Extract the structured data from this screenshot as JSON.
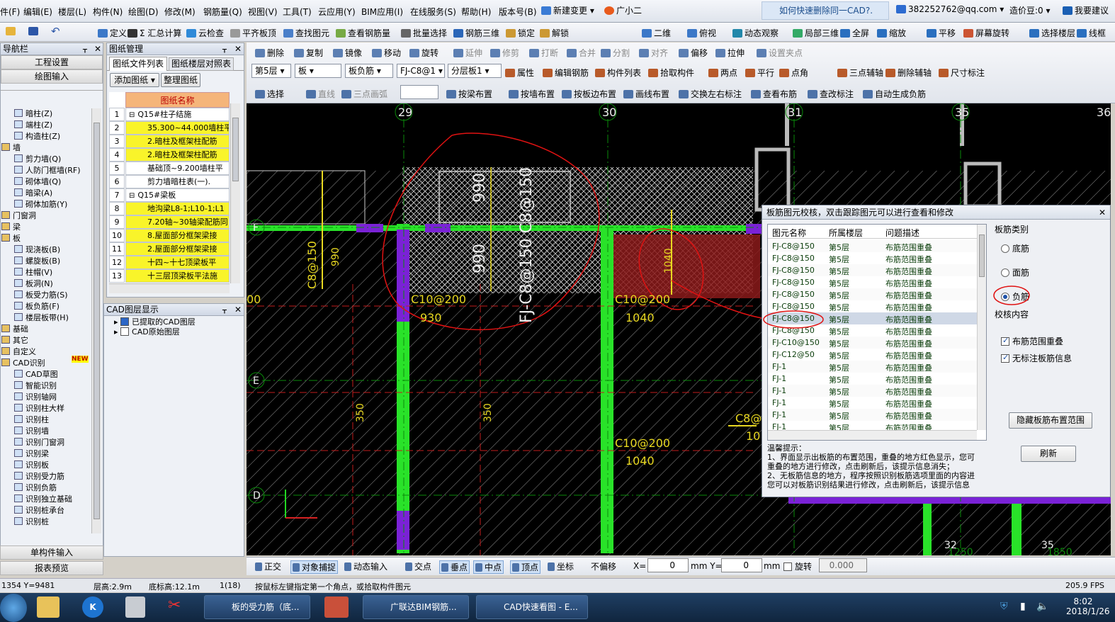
{
  "menubar": {
    "items": [
      "件(F)",
      "编辑(E)",
      "楼层(L)",
      "构件(N)",
      "绘图(D)",
      "修改(M)",
      "钢筋量(Q)",
      "视图(V)",
      "工具(T)",
      "云应用(Y)",
      "BIM应用(I)",
      "在线服务(S)",
      "帮助(H)",
      "版本号(B)"
    ],
    "new_change": "新建变更",
    "assistant": "广小二",
    "search_hint": "如何快速删除同一CAD?.",
    "account": "382252762@qq.com",
    "cost_beans": "造价豆:0",
    "feedback": "我要建议"
  },
  "toolbar1": {
    "items": [
      "定义",
      "Σ 汇总计算",
      "云检查",
      "平齐板顶",
      "查找图元",
      "查看钢筋量",
      "批量选择",
      "钢筋三维",
      "锁定",
      "解锁",
      "二维",
      "俯视",
      "动态观察",
      "局部三维",
      "全屏",
      "缩放",
      "平移",
      "屏幕旋转",
      "选择楼层",
      "线框"
    ]
  },
  "nav": {
    "title": "导航栏",
    "project_settings": "工程设置",
    "drawing_input": "绘图输入",
    "tree": [
      "暗柱(Z)",
      "端柱(Z)",
      "构造柱(Z)",
      "墙",
      "剪力墙(Q)",
      "人防门框墙(RF)",
      "砌体墙(Q)",
      "暗梁(A)",
      "砌体加筋(Y)",
      "门窗洞",
      "梁",
      "板",
      "现浇板(B)",
      "螺旋板(B)",
      "柱帽(V)",
      "板洞(N)",
      "板受力筋(S)",
      "板负筋(F)",
      "楼层板带(H)",
      "基础",
      "其它",
      "自定义",
      "CAD识别",
      "CAD草图",
      "智能识别",
      "识别轴网",
      "识别柱大样",
      "识别柱",
      "识别墙",
      "识别门窗洞",
      "识别梁",
      "识别板",
      "识别受力筋",
      "识别负筋",
      "识别独立基础",
      "识别桩承台",
      "识别桩"
    ],
    "new_badge": "NEW",
    "single_input": "单构件输入",
    "report_preview": "报表预览"
  },
  "drawings": {
    "title": "图纸管理",
    "tab1": "图纸文件列表",
    "tab2": "图纸楼层对照表",
    "add": "添加图纸",
    "organize": "整理图纸",
    "col": "图纸名称",
    "rows": [
      [
        "1",
        "Q15#柱子结施"
      ],
      [
        "2",
        "35.300~44.000墙柱平"
      ],
      [
        "3",
        "2.暗柱及框架柱配筋"
      ],
      [
        "4",
        "2.暗柱及框架柱配筋"
      ],
      [
        "5",
        "基础顶~9.200墙柱平"
      ],
      [
        "6",
        "剪力墙暗柱表(一)."
      ],
      [
        "7",
        "Q15#梁板"
      ],
      [
        "8",
        "地沟梁L8-1;L10-1;L1"
      ],
      [
        "9",
        "7.20轴~30轴梁配筋同"
      ],
      [
        "10",
        "8.屋面部分框架梁接"
      ],
      [
        "11",
        "2.屋面部分框架梁接"
      ],
      [
        "12",
        "十四~十七顶梁板平"
      ],
      [
        "13",
        "十三层顶梁板平法施"
      ]
    ]
  },
  "cad_layers": {
    "title": "CAD图层显示",
    "items": [
      "已提取的CAD图层",
      "CAD原始图层"
    ]
  },
  "toolbar2": {
    "items": [
      "删除",
      "复制",
      "镜像",
      "移动",
      "旋转",
      "延伸",
      "修剪",
      "打断",
      "合并",
      "分割",
      "对齐",
      "偏移",
      "拉伸",
      "设置夹点"
    ]
  },
  "toolbar3": {
    "floor": "第5层",
    "category": "板",
    "type": "板负筋",
    "element": "FJ-C8@1",
    "layer": "分层板1",
    "items": [
      "属性",
      "编辑钢筋",
      "构件列表",
      "拾取构件",
      "两点",
      "平行",
      "点角",
      "三点辅轴",
      "删除辅轴",
      "尺寸标注"
    ]
  },
  "toolbar4": {
    "items": [
      "选择",
      "直线",
      "三点画弧",
      "按梁布置",
      "按墙布置",
      "按板边布置",
      "画线布置",
      "交换左右标注",
      "查看布筋",
      "查改标注",
      "自动生成负筋"
    ]
  },
  "canvas": {
    "axes": [
      "29",
      "30",
      "31",
      "35",
      "36"
    ],
    "row_axes": [
      "F",
      "E",
      "D"
    ],
    "labels": [
      "990",
      "990",
      "C8@150",
      "990",
      "FJ-C8@150 C8@150",
      "C10@200",
      "930",
      "C10@200",
      "1040",
      "C10@200",
      "1040",
      "350",
      "350",
      "1040",
      "00",
      "C8@",
      "10",
      "32",
      "35",
      "1250",
      "1850"
    ]
  },
  "dialog": {
    "title": "板筋图元校核，双击跟踪图元可以进行查看和修改",
    "cols": [
      "图元名称",
      "所属楼层",
      "问题描述"
    ],
    "rows": [
      [
        "FJ-C8@150",
        "第5层",
        "布筋范围重叠"
      ],
      [
        "FJ-C8@150",
        "第5层",
        "布筋范围重叠"
      ],
      [
        "FJ-C8@150",
        "第5层",
        "布筋范围重叠"
      ],
      [
        "FJ-C8@150",
        "第5层",
        "布筋范围重叠"
      ],
      [
        "FJ-C8@150",
        "第5层",
        "布筋范围重叠"
      ],
      [
        "FJ-C8@150",
        "第5层",
        "布筋范围重叠"
      ],
      [
        "FJ-C8@150",
        "第5层",
        "布筋范围重叠"
      ],
      [
        "FJ-C8@150",
        "第5层",
        "布筋范围重叠"
      ],
      [
        "FJ-C10@150",
        "第5层",
        "布筋范围重叠"
      ],
      [
        "FJ-C12@50",
        "第5层",
        "布筋范围重叠"
      ],
      [
        "FJ-1",
        "第5层",
        "布筋范围重叠"
      ],
      [
        "FJ-1",
        "第5层",
        "布筋范围重叠"
      ],
      [
        "FJ-1",
        "第5层",
        "布筋范围重叠"
      ],
      [
        "FJ-1",
        "第5层",
        "布筋范围重叠"
      ],
      [
        "FJ-1",
        "第5层",
        "布筋范围重叠"
      ],
      [
        "FJ-1",
        "第5层",
        "布筋范围重叠"
      ]
    ],
    "category_label": "板筋类别",
    "opt_bottom": "底筋",
    "opt_top": "面筋",
    "opt_neg": "负筋",
    "check_label": "校核内容",
    "chk1": "布筋范围重叠",
    "chk2": "无标注板筋信息",
    "hide_btn": "隐藏板筋布置范围",
    "refresh_btn": "刷新",
    "tips": [
      "温馨提示：",
      "1、界面显示出板筋的布置范围，重叠的地方红色显示，您可",
      "重叠的地方进行修改，点击刷新后，该提示信息消失；",
      "2、无板筋信息的地方，程序按照识别板筋选项里面的内容进",
      "您可以对板筋识别结果进行修改，点击刷新后，该提示信息"
    ]
  },
  "snapbar": {
    "items": [
      "正交",
      "对象捕捉",
      "动态输入",
      "交点",
      "垂点",
      "中点",
      "顶点",
      "坐标",
      "不偏移"
    ],
    "x_label": "X=",
    "x_val": "0",
    "y_label": "mm Y=",
    "y_val": "0",
    "unit": "mm",
    "rotate": "旋转",
    "rot_val": "0.000"
  },
  "status": {
    "coords": "1354 Y=9481",
    "floor_height": "层高:2.9m",
    "bottom_height": "底标高:12.1m",
    "count": "1(18)",
    "hint": "按鼠标左键指定第一个角点，或拾取构件图元",
    "fps": "205.9 FPS"
  },
  "taskbar": {
    "tasks": [
      "板的受力筋（底...",
      "广联达BIM钢筋...",
      "CAD快速看图 - E..."
    ],
    "time": "8:02",
    "date": "2018/1/26"
  }
}
